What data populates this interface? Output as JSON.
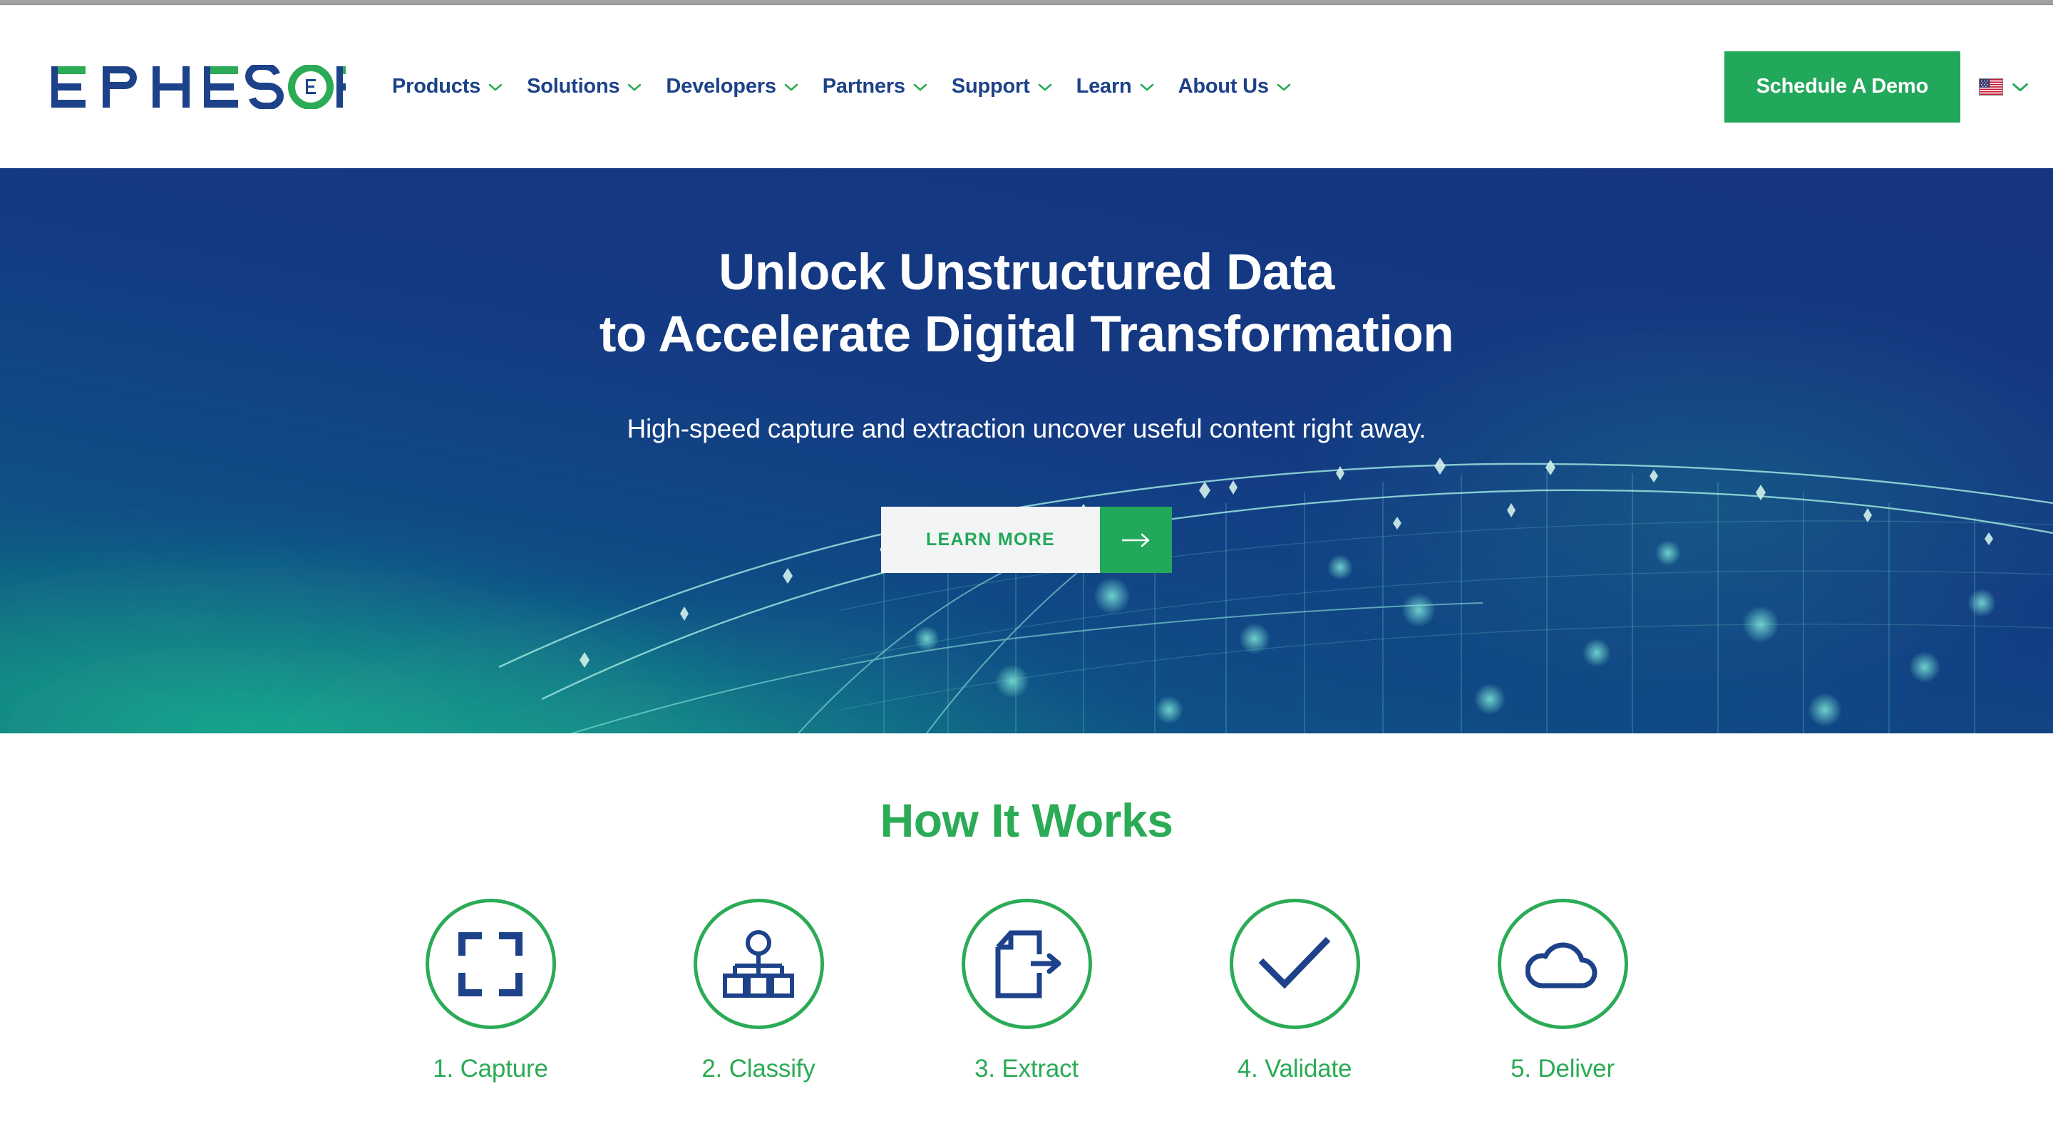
{
  "brand": {
    "logo_text": "EPHESOFT",
    "navy": "#1d4289",
    "green": "#2bab55"
  },
  "header": {
    "nav_items": [
      {
        "label": "Products"
      },
      {
        "label": "Solutions"
      },
      {
        "label": "Developers"
      },
      {
        "label": "Partners"
      },
      {
        "label": "Support"
      },
      {
        "label": "Learn"
      },
      {
        "label": "About Us"
      }
    ],
    "demo_button": "Schedule A Demo",
    "language_flag": "us-flag-icon",
    "language_chevron": "chevron-down-icon"
  },
  "hero": {
    "title_line1": "Unlock Unstructured Data",
    "title_line2": "to Accelerate Digital Transformation",
    "subtitle": "High-speed capture and extraction uncover useful content right away.",
    "cta_label": "LEARN MORE",
    "cta_arrow": "arrow-right-icon",
    "background_color": "#143a83",
    "accent_color": "#2bab55"
  },
  "how_it_works": {
    "title": "How It Works",
    "steps": [
      {
        "label": "1. Capture",
        "icon": "capture-frame-icon"
      },
      {
        "label": "2. Classify",
        "icon": "hierarchy-tree-icon"
      },
      {
        "label": "3. Extract",
        "icon": "document-export-icon"
      },
      {
        "label": "4. Validate",
        "icon": "checkmark-icon"
      },
      {
        "label": "5. Deliver",
        "icon": "cloud-icon"
      }
    ]
  }
}
